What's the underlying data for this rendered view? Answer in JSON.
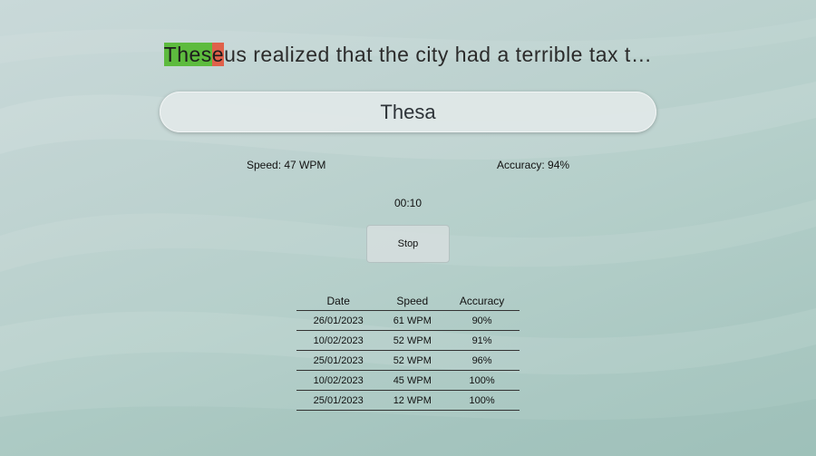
{
  "quote": {
    "correct": "Thes",
    "error": "e",
    "rest": "us realized that the city had a terrible tax t…"
  },
  "input": {
    "value": "Thesa"
  },
  "stats": {
    "speed": "Speed: 47 WPM",
    "accuracy": "Accuracy: 94%"
  },
  "timer": "00:10",
  "stop_label": "Stop",
  "history": {
    "headers": [
      "Date",
      "Speed",
      "Accuracy"
    ],
    "rows": [
      [
        "26/01/2023",
        "61 WPM",
        "90%"
      ],
      [
        "10/02/2023",
        "52 WPM",
        "91%"
      ],
      [
        "25/01/2023",
        "52 WPM",
        "96%"
      ],
      [
        "10/02/2023",
        "45 WPM",
        "100%"
      ],
      [
        "25/01/2023",
        "12 WPM",
        "100%"
      ]
    ]
  },
  "colors": {
    "correct_highlight": "#5dbb3e",
    "error_highlight": "#e0614a"
  }
}
